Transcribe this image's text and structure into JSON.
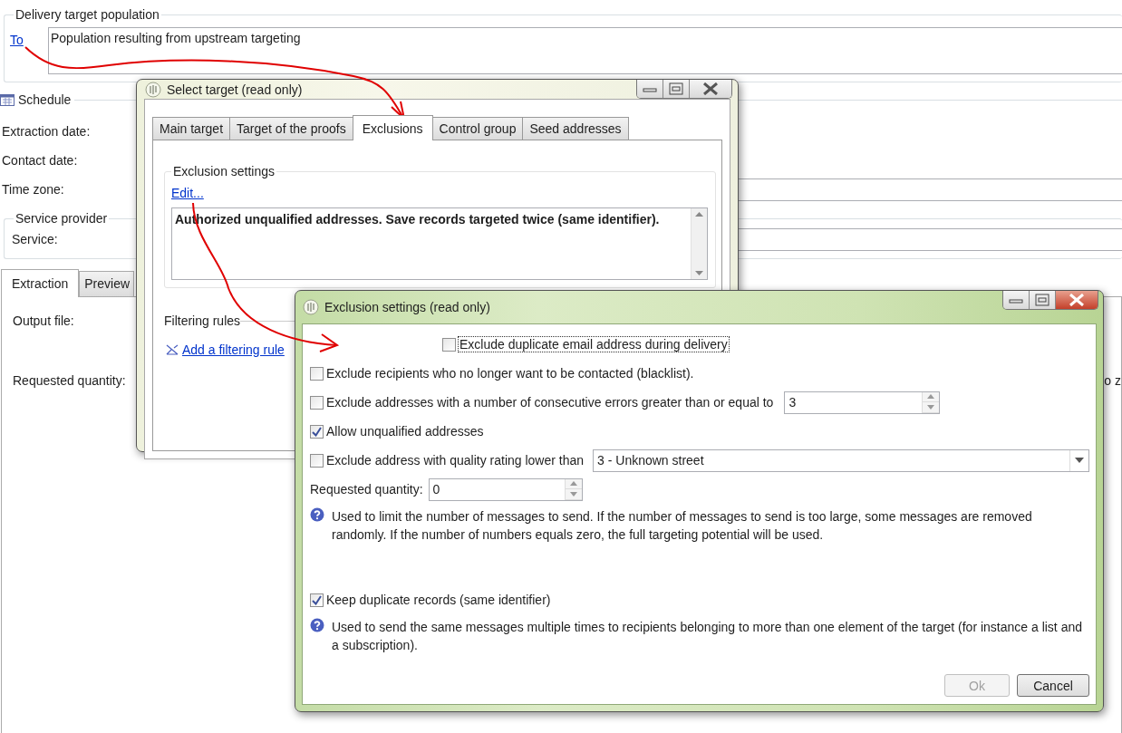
{
  "main_form": {
    "target_section": {
      "title": "Delivery target population",
      "link": "To",
      "value": "Population resulting from upstream targeting"
    },
    "schedule": {
      "title": "Schedule",
      "fields": [
        {
          "label": "Extraction date:",
          "has_field": false
        },
        {
          "label": "Contact date:",
          "has_field": false
        },
        {
          "label": "Time zone:",
          "has_field": true
        }
      ]
    },
    "service_provider": {
      "title": "Service provider",
      "fields": [
        {
          "label": "Service:",
          "has_field": true
        }
      ]
    },
    "tabs": [
      {
        "label": "Extraction",
        "selected": true
      },
      {
        "label": "Preview",
        "selected": false
      }
    ],
    "extraction_fields": [
      {
        "label": "Output file:"
      },
      {
        "label": "Requested quantity:",
        "cut_text": "o z"
      }
    ]
  },
  "select_target_dialog": {
    "title": "Select target (read only)",
    "tabs": [
      {
        "label": "Main target",
        "selected": false
      },
      {
        "label": "Target of the proofs",
        "selected": false
      },
      {
        "label": "Exclusions",
        "selected": true
      },
      {
        "label": "Control group",
        "selected": false
      },
      {
        "label": "Seed addresses",
        "selected": false
      }
    ],
    "exclusion_settings": {
      "title": "Exclusion settings",
      "link": "Edit...",
      "summary": "Authorized unqualified addresses. Save records targeted twice (same identifier)."
    },
    "filtering_rules": {
      "title": "Filtering rules",
      "link": "Add a filtering rule"
    }
  },
  "exclusion_dialog": {
    "title": "Exclusion settings (read only)",
    "rows": [
      {
        "kind": "checkbox",
        "label": "Exclude duplicate email address during delivery",
        "checked": false,
        "focused": true
      },
      {
        "kind": "checkbox",
        "label": "Exclude recipients who no longer want to be contacted (blacklist).",
        "checked": false,
        "focused": false
      },
      {
        "kind": "checkbox_spin",
        "label": "Exclude addresses with a number of consecutive errors greater than or equal to",
        "checked": false,
        "focused": false,
        "value": "3"
      },
      {
        "kind": "checkbox",
        "label": "Allow unqualified addresses",
        "checked": true,
        "focused": false
      },
      {
        "kind": "checkbox_select",
        "label": "Exclude address with quality rating lower than",
        "checked": false,
        "focused": false,
        "value": "3 - Unknown street"
      },
      {
        "kind": "spin",
        "label": "Requested quantity:",
        "value": "0"
      },
      {
        "kind": "help",
        "text": "Used to limit the number of messages to send. If the number of messages to send is too large, some messages are removed randomly. If the number of numbers equals zero, the full targeting potential will be used."
      },
      {
        "kind": "checkbox",
        "label": "Keep duplicate records (same identifier)",
        "checked": true,
        "focused": false
      },
      {
        "kind": "help",
        "text": "Used to send the same messages multiple times to recipients belonging to more than one element of the target (for instance a list and a subscription)."
      }
    ],
    "buttons": [
      {
        "label": "Ok",
        "disabled": true
      },
      {
        "label": "Cancel",
        "disabled": false
      }
    ]
  }
}
